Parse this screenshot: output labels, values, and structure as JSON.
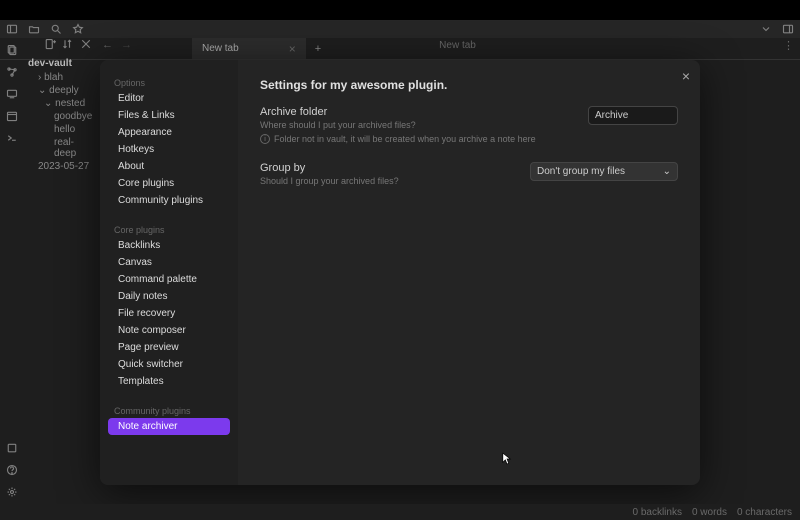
{
  "titlebar": {
    "icons_left": [
      "sidebar-left",
      "folder",
      "search",
      "star"
    ],
    "icons_right": [
      "chevron-down",
      "sidebar-right"
    ]
  },
  "tab": {
    "title": "New tab",
    "crumb": "New tab"
  },
  "vault": {
    "name": "dev-vault",
    "tree": [
      {
        "label": "blah",
        "indent": 1,
        "chev": "›"
      },
      {
        "label": "deeply",
        "indent": 1,
        "chev": "⌄"
      },
      {
        "label": "nested",
        "indent": 2,
        "chev": "⌄"
      },
      {
        "label": "goodbye",
        "indent": 3
      },
      {
        "label": "hello",
        "indent": 3
      },
      {
        "label": "real-deep",
        "indent": 3
      },
      {
        "label": "2023-05-27",
        "indent": 1
      }
    ]
  },
  "settings": {
    "title": "Settings for my awesome plugin.",
    "options_h": "Options",
    "options": [
      "Editor",
      "Files & Links",
      "Appearance",
      "Hotkeys",
      "About",
      "Core plugins",
      "Community plugins"
    ],
    "core_h": "Core plugins",
    "core": [
      "Backlinks",
      "Canvas",
      "Command palette",
      "Daily notes",
      "File recovery",
      "Note composer",
      "Page preview",
      "Quick switcher",
      "Templates"
    ],
    "community_h": "Community plugins",
    "community": [
      {
        "label": "Note archiver",
        "active": true
      }
    ],
    "archive": {
      "name": "Archive folder",
      "desc": "Where should I put your archived files?",
      "info": "Folder not in vault, it will be created when you archive a note here",
      "value": "Archive"
    },
    "groupby": {
      "name": "Group by",
      "desc": "Should I group your archived files?",
      "value": "Don't group my files"
    }
  },
  "status": {
    "backlinks": "0 backlinks",
    "words": "0 words",
    "chars": "0 characters"
  }
}
